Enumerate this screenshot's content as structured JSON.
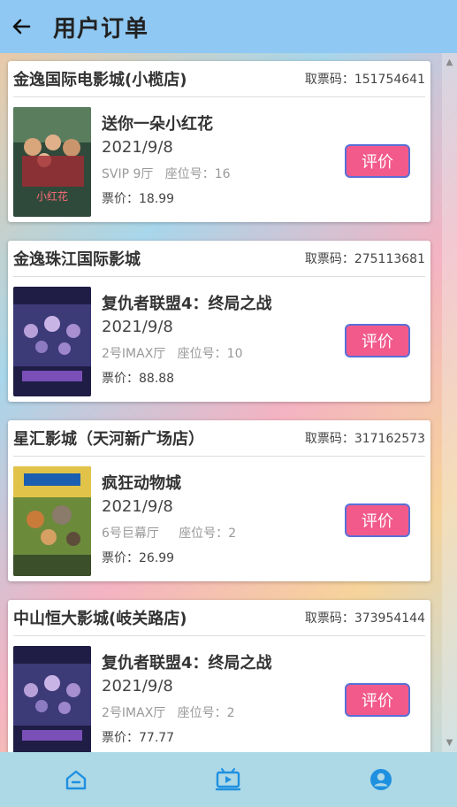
{
  "header": {
    "title": "用户订单",
    "back_icon": "arrow-left-icon"
  },
  "labels": {
    "code_prefix": "取票码：",
    "seat_prefix": "座位号：",
    "price_prefix": "票价：",
    "rate_button": "评价"
  },
  "orders": [
    {
      "cinema": "金逸国际电影城(小榄店)",
      "code": "151754641",
      "movie": "送你一朵小红花",
      "date": "2021/9/8",
      "hall": "SVIP 9厅",
      "seat": "16",
      "price": "18.99",
      "poster_color": "#2f4a3a"
    },
    {
      "cinema": "金逸珠江国际影城",
      "code": "275113681",
      "movie": "复仇者联盟4：终局之战",
      "date": "2021/9/8",
      "hall": "2号IMAX厅",
      "seat": "10",
      "price": "88.88",
      "poster_color": "#2b2a55"
    },
    {
      "cinema": "星汇影城（天河新广场店）",
      "code": "317162573",
      "movie": "疯狂动物城",
      "date": "2021/9/8",
      "hall": "6号巨幕厅",
      "seat": "2",
      "price": "26.99",
      "poster_color": "#6b8a3a"
    },
    {
      "cinema": "中山恒大影城(岐关路店)",
      "code": "373954144",
      "movie": "复仇者联盟4：终局之战",
      "date": "2021/9/8",
      "hall": "2号IMAX厅",
      "seat": "2",
      "price": "77.77",
      "poster_color": "#2b2a55"
    }
  ],
  "footer": {
    "nav": [
      "home-icon",
      "movie-icon",
      "user-icon"
    ],
    "accent": "#1e90e0"
  }
}
